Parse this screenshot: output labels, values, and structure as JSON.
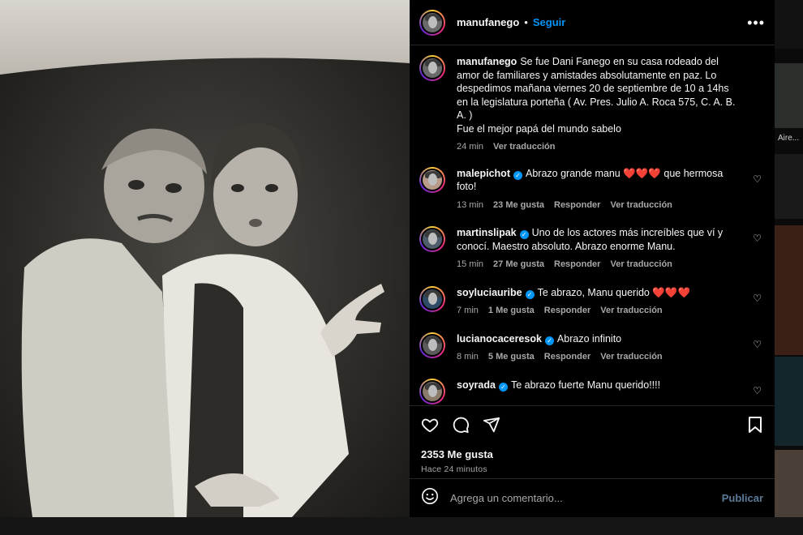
{
  "post": {
    "username": "manufanego",
    "follow_label": "Seguir",
    "separator": "•",
    "more_label": "•••",
    "caption": {
      "username": "manufanego",
      "text": "Se fue Dani Fanego en su casa rodeado del amor de familiares y amistades absolutamente en paz. Lo despedimos mañana viernes 20 de septiembre de 10 a 14hs en la legislatura porteña ( Av. Pres. Julio A. Roca 575, C. A. B. A. )\nFue el mejor papá del mundo sabelo",
      "time": "24 min",
      "translate": "Ver traducción"
    },
    "comments": [
      {
        "username": "malepichot",
        "text": "Abrazo grande manu ❤️❤️❤️ que hermosa foto!",
        "time": "13 min",
        "likes": "23 Me gusta",
        "reply": "Responder",
        "translate": "Ver traducción"
      },
      {
        "username": "martinslipak",
        "text": "Uno de los actores más increíbles que ví y conocí. Maestro absoluto. Abrazo enorme Manu.",
        "time": "15 min",
        "likes": "27 Me gusta",
        "reply": "Responder",
        "translate": "Ver traducción"
      },
      {
        "username": "soyluciauribe",
        "text": "Te abrazo, Manu querido ❤️❤️❤️",
        "time": "7 min",
        "likes": "1 Me gusta",
        "reply": "Responder",
        "translate": "Ver traducción"
      },
      {
        "username": "lucianocaceresok",
        "text": "Abrazo infinito",
        "time": "8 min",
        "likes": "5 Me gusta",
        "reply": "Responder",
        "translate": "Ver traducción"
      },
      {
        "username": "soyrada",
        "text": "Te abrazo fuerte Manu querido!!!!",
        "time": "",
        "likes": "",
        "reply": "",
        "translate": ""
      }
    ],
    "like_count": "2353 Me gusta",
    "posted_ago": "Hace 24 minutos",
    "comment_placeholder": "Agrega un comentario...",
    "publish_label": "Publicar"
  },
  "background": {
    "side_text": "Aire..."
  },
  "icons": {
    "more": "more-options-icon",
    "like": "heart-icon",
    "comment": "comment-icon",
    "share": "send-icon",
    "save": "bookmark-icon",
    "emoji": "emoji-icon",
    "verified": "verified-badge-icon"
  },
  "colors": {
    "accent": "#0095f6",
    "panel_bg": "#000000",
    "muted_text": "#a8a8a8",
    "divider": "#262626"
  }
}
